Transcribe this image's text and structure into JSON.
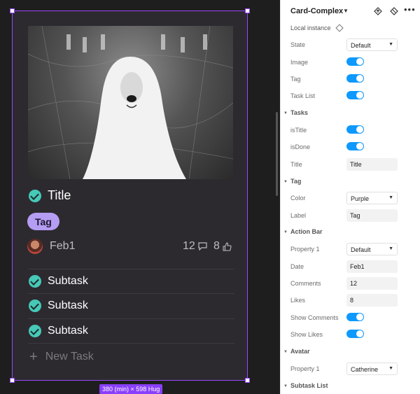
{
  "card": {
    "title": "Title",
    "tag": "Tag",
    "date": "Feb1",
    "comments": "12",
    "likes": "8",
    "subtasks": [
      "Subtask",
      "Subtask",
      "Subtask"
    ],
    "new_task": "New Task",
    "size_badge": "380 (min) × 598 Hug"
  },
  "panel": {
    "component_name": "Card-Complex",
    "local_instance": "Local instance",
    "rows": {
      "state_label": "State",
      "state_value": "Default",
      "image_label": "Image",
      "tag_label": "Tag",
      "tasklist_label": "Task List"
    },
    "tasks": {
      "section": "Tasks",
      "istitle_label": "isTitle",
      "isdone_label": "isDone",
      "title_label": "Title",
      "title_value": "Title"
    },
    "tag": {
      "section": "Tag",
      "color_label": "Color",
      "color_value": "Purple",
      "label_label": "Label",
      "label_value": "Tag"
    },
    "action_bar": {
      "section": "Action Bar",
      "property_label": "Property 1",
      "property_value": "Default",
      "date_label": "Date",
      "date_value": "Feb1",
      "comments_label": "Comments",
      "comments_value": "12",
      "likes_label": "Likes",
      "likes_value": "8",
      "show_comments_label": "Show Comments",
      "show_likes_label": "Show Likes"
    },
    "avatar": {
      "section": "Avatar",
      "property_label": "Property 1",
      "property_value": "Catherine"
    },
    "subtask_list": {
      "section": "Subtask List"
    }
  },
  "colors": {
    "accent": "#47c9b8",
    "tag": "#b49df2",
    "toggle": "#0d99ff",
    "selection": "#9747ff"
  }
}
